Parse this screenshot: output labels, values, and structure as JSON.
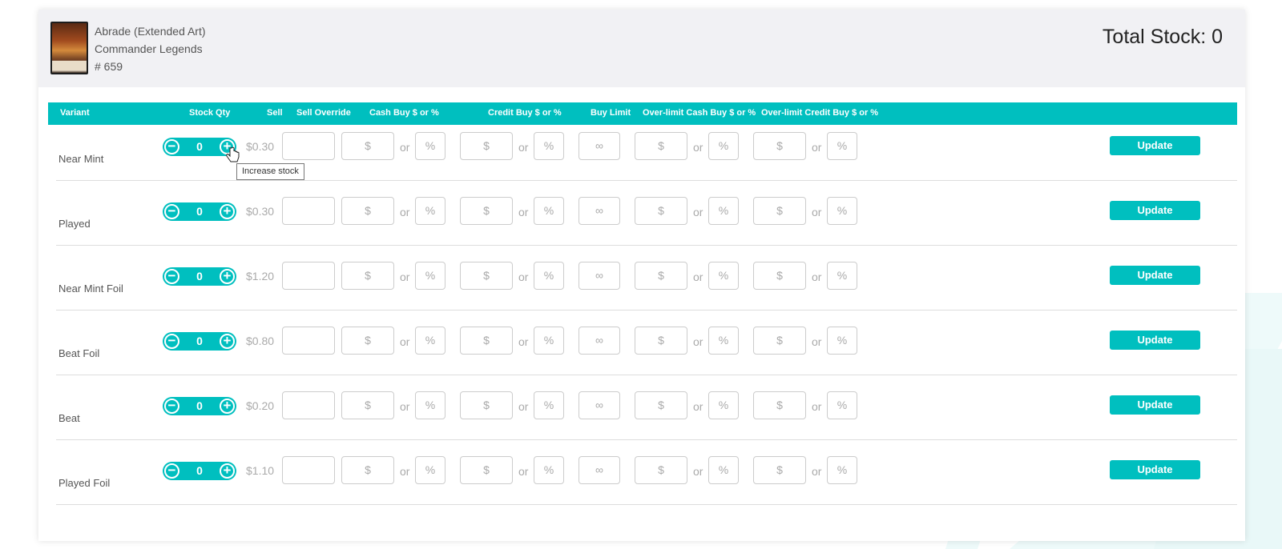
{
  "card": {
    "name": "Abrade (Extended Art)",
    "set": "Commander Legends",
    "number": "# 659",
    "total_stock": "Total Stock: 0"
  },
  "columns": {
    "variant": "Variant",
    "stock_qty": "Stock Qty",
    "sell": "Sell",
    "sell_override": "Sell Override",
    "cash_buy": "Cash Buy $ or %",
    "credit_buy": "Credit Buy $ or %",
    "buy_limit": "Buy Limit",
    "over_cash": "Over-limit Cash Buy $ or %",
    "over_credit": "Over-limit Credit Buy $ or %"
  },
  "placeholders": {
    "dollar": "$",
    "percent": "%",
    "or": "or",
    "infinity": "∞"
  },
  "update_label": "Update",
  "tooltip": "Increase stock",
  "rows": [
    {
      "variant": "Near Mint",
      "qty": "0",
      "sell": "$0.30"
    },
    {
      "variant": "Played",
      "qty": "0",
      "sell": "$0.30"
    },
    {
      "variant": "Near Mint Foil",
      "qty": "0",
      "sell": "$1.20"
    },
    {
      "variant": "Beat Foil",
      "qty": "0",
      "sell": "$0.80"
    },
    {
      "variant": "Beat",
      "qty": "0",
      "sell": "$0.20"
    },
    {
      "variant": "Played Foil",
      "qty": "0",
      "sell": "$1.10"
    }
  ],
  "colors": {
    "accent": "#00bfbf"
  },
  "icons": {
    "minus": "minus-circle-icon",
    "plus": "plus-circle-icon",
    "cursor": "hand-cursor-icon"
  }
}
